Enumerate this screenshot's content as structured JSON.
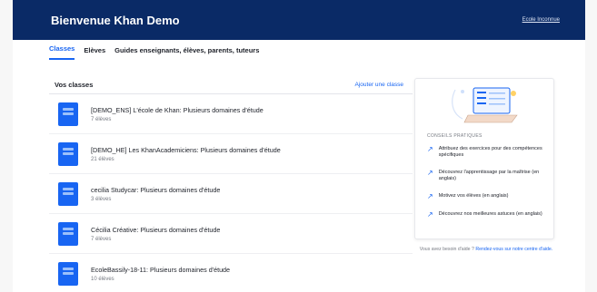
{
  "header": {
    "title": "Bienvenue Khan Demo",
    "school_link": "Ecole Inconnue"
  },
  "tabs": [
    {
      "label": "Classes",
      "active": true
    },
    {
      "label": "Elèves",
      "active": false
    },
    {
      "label": "Guides enseignants, élèves, parents, tuteurs",
      "active": false
    }
  ],
  "classes_panel": {
    "title": "Vos classes",
    "add_label": "Ajouter une classe",
    "items": [
      {
        "name": "[DEMO_ENS] L'école de Khan: Plusieurs domaines d'étude",
        "count": "7 élèves"
      },
      {
        "name": "[DEMO_HE] Les KhanAcademiciens: Plusieurs domaines d'étude",
        "count": "21 élèves"
      },
      {
        "name": "cecilia Studycar: Plusieurs domaines d'étude",
        "count": "3 élèves"
      },
      {
        "name": "Cécilia Créative: Plusieurs domaines d'étude",
        "count": "7 élèves"
      },
      {
        "name": "EcoleBassily-18-11: Plusieurs domaines d'étude",
        "count": "10 élèves"
      }
    ]
  },
  "tips": {
    "label": "CONSEILS PRATIQUES",
    "items": [
      "Attribuez des exercices pour des compétences spécifiques",
      "Découvrez l'apprentissage par la maîtrise (en anglais)",
      "Motivez vos élèves (en anglais)",
      "Découvrez nos meilleures astuces (en anglais)"
    ]
  },
  "help": {
    "prefix": "Vous avez besoin d'aide ?",
    "link": "Rendez-vous sur notre centre d'aide."
  },
  "colors": {
    "brand": "#0a2a66",
    "accent": "#1865f2"
  }
}
